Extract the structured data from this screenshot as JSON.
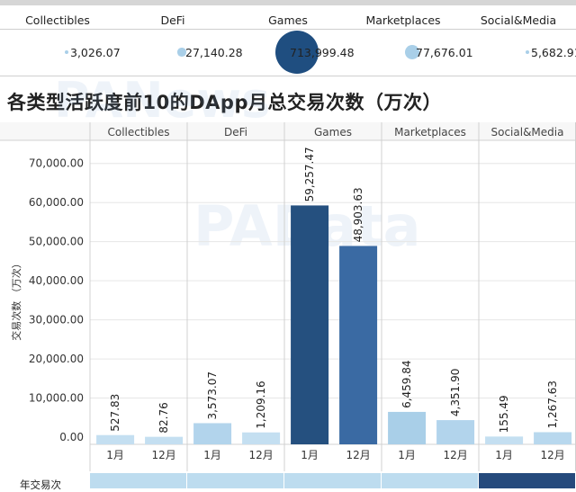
{
  "top_table": {
    "categories": [
      "Collectibles",
      "DeFi",
      "Games",
      "Marketplaces",
      "Social&Media"
    ],
    "totals": [
      "3,026.07",
      "27,140.28",
      "713,999.48",
      "77,676.01",
      "5,682.91"
    ],
    "total_values": [
      3026.07,
      27140.28,
      713999.48,
      77676.01,
      5682.91
    ],
    "bubble_colors": [
      "#a9cfe8",
      "#a9cfe8",
      "#1f4e80",
      "#a9cfe8",
      "#a9cfe8"
    ]
  },
  "title": "各类型活跃度前10的DApp月总交易次数（万次）",
  "watermarks": [
    "PANews",
    "PAData"
  ],
  "bottom": {
    "label": "年交易次",
    "strip_colors": [
      "#bddcef",
      "#bddcef",
      "#bddcef",
      "#bddcef",
      "#254a7c"
    ]
  },
  "chart_data": {
    "type": "bar",
    "ylabel": "交易次数 （万次）",
    "ylim": [
      0,
      75000
    ],
    "yticks": [
      0,
      10000,
      20000,
      30000,
      40000,
      50000,
      60000,
      70000
    ],
    "ytick_labels": [
      "0.00",
      "10,000.00",
      "20,000.00",
      "30,000.00",
      "40,000.00",
      "50,000.00",
      "60,000.00",
      "70,000.00"
    ],
    "grid": true,
    "facets": [
      {
        "name": "Collectibles",
        "categories": [
          "1月",
          "12月"
        ],
        "values": [
          527.83,
          82.76
        ],
        "labels": [
          "527.83",
          "82.76"
        ],
        "colors": [
          "#c4dff1",
          "#c4dff1"
        ]
      },
      {
        "name": "DeFi",
        "categories": [
          "1月",
          "12月"
        ],
        "values": [
          3573.07,
          1209.16
        ],
        "labels": [
          "3,573.07",
          "1,209.16"
        ],
        "colors": [
          "#b2d4ec",
          "#c4dff1"
        ]
      },
      {
        "name": "Games",
        "categories": [
          "1月",
          "12月"
        ],
        "values": [
          59257.47,
          48903.63
        ],
        "labels": [
          "59,257.47",
          "48,903.63"
        ],
        "colors": [
          "#25507f",
          "#3a6aa3"
        ]
      },
      {
        "name": "Marketplaces",
        "categories": [
          "1月",
          "12月"
        ],
        "values": [
          6459.84,
          4351.9
        ],
        "labels": [
          "6,459.84",
          "4,351.90"
        ],
        "colors": [
          "#a9cfe8",
          "#b2d4ec"
        ]
      },
      {
        "name": "Social&Media",
        "categories": [
          "1月",
          "12月"
        ],
        "values": [
          155.49,
          1267.63
        ],
        "labels": [
          "155.49",
          "1,267.63"
        ],
        "colors": [
          "#c4dff1",
          "#b8d8ee"
        ]
      }
    ]
  }
}
